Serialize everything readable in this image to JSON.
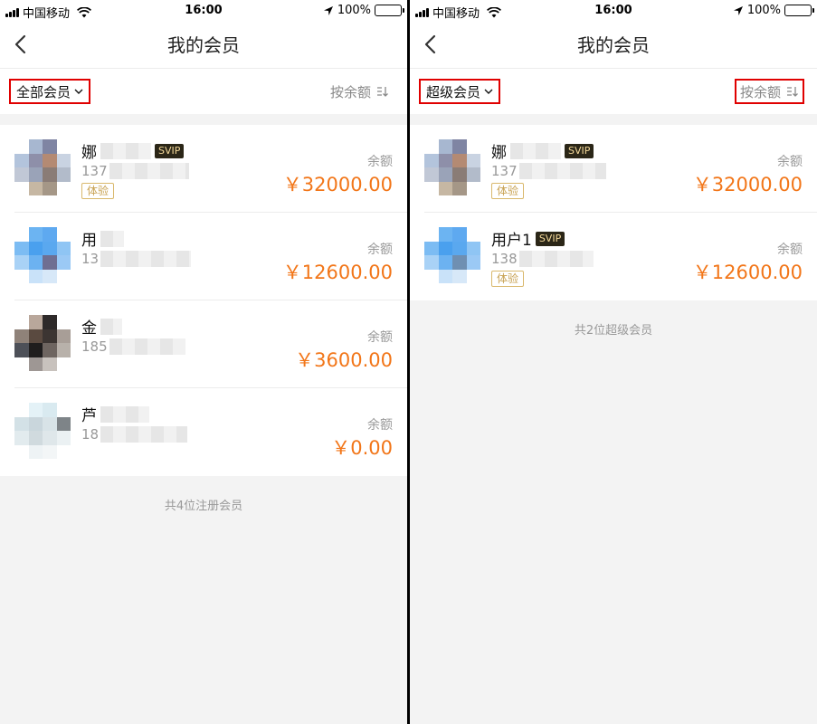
{
  "status": {
    "carrier": "中国移动",
    "time": "16:00",
    "battery": "100%"
  },
  "left": {
    "title": "我的会员",
    "filter_label": "全部会员",
    "sort_label": "按余额",
    "footer": "共4位注册会员",
    "members": [
      {
        "name": "娜",
        "svip": "SVIP",
        "phone": "137",
        "trial": "体验",
        "balance_label": "余额",
        "balance": "￥32000.00"
      },
      {
        "name": "用",
        "phone": "13",
        "balance_label": "余额",
        "balance": "￥12600.00"
      },
      {
        "name": "金",
        "phone": "185",
        "balance_label": "余额",
        "balance": "￥3600.00"
      },
      {
        "name": "芦",
        "phone": "18",
        "balance_label": "余额",
        "balance": "￥0.00"
      }
    ]
  },
  "right": {
    "title": "我的会员",
    "filter_label": "超级会员",
    "sort_label": "按余额",
    "footer": "共2位超级会员",
    "members": [
      {
        "name": "娜",
        "svip": "SVIP",
        "phone": "137",
        "trial": "体验",
        "balance_label": "余额",
        "balance": "￥32000.00"
      },
      {
        "name": "用户1",
        "svip": "SVIP",
        "phone": "138",
        "trial": "体验",
        "balance_label": "余额",
        "balance": "￥12600.00"
      }
    ]
  },
  "colors": {
    "accent_price": "#f27619",
    "highlight_box": "#e00000",
    "svip_bg": "#2b2617",
    "trial_gold": "#c8a252"
  }
}
